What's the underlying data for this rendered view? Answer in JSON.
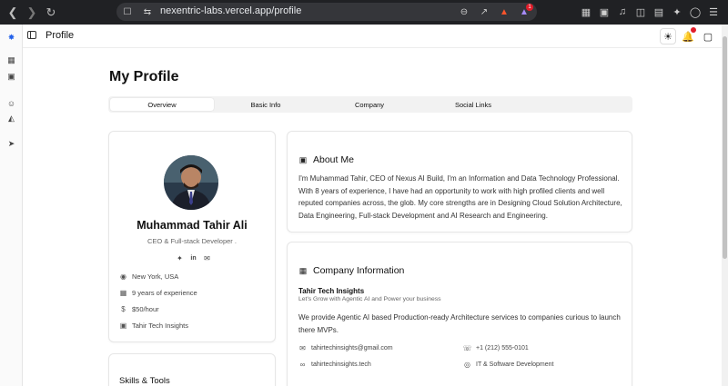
{
  "browser": {
    "url_host": "nexentric-labs.vercel.app",
    "url_path": "/profile",
    "brave_badge": "1"
  },
  "topbar": {
    "title": "Profile"
  },
  "page": {
    "title": "My Profile"
  },
  "tabs": [
    {
      "label": "Overview",
      "active": true
    },
    {
      "label": "Basic Info",
      "active": false
    },
    {
      "label": "Company",
      "active": false
    },
    {
      "label": "Social Links",
      "active": false
    }
  ],
  "profile": {
    "name": "Muhammad Tahir Ali",
    "role": "CEO & Full-stack Developer .",
    "details": [
      {
        "icon": "map-pin-icon",
        "text": "New York, USA"
      },
      {
        "icon": "calendar-icon",
        "text": "9 years of experience"
      },
      {
        "icon": "dollar-icon",
        "text": "$50/hour"
      },
      {
        "icon": "building-icon",
        "text": "Tahir Tech Insights"
      }
    ]
  },
  "about": {
    "heading": "About Me",
    "text": "I'm Muhammad Tahir, CEO of Nexus AI Build, I'm an Information and Data Technology Professional. With 8 years of experience, I have had an opportunity to work with high profiled clients and well reputed companies across, the glob. My core strengths are in Designing Cloud Solution Architecture, Data Engineering, Full-stack Development and AI Research and Engineering."
  },
  "company": {
    "heading": "Company Information",
    "name": "Tahir Tech Insights",
    "tagline": "Let's Grow with Agentic AI and Power your business",
    "description": "We provide Agentic AI based Production-ready Architecture services to companies curious to launch there MVPs.",
    "email": "tahirtechinsights@gmail.com",
    "phone": "+1 (212) 555-0101",
    "website": "tahirtechinsights.tech",
    "industry": "IT & Software Development"
  },
  "skills": {
    "heading": "Skills & Tools"
  },
  "colors": {
    "accent_red": "#e11d2a",
    "chrome_bg": "#202124"
  }
}
